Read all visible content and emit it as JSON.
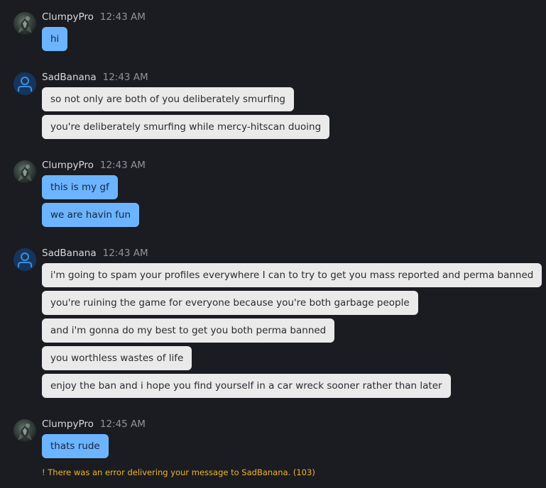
{
  "colors": {
    "background": "#1a1c22",
    "own_bubble": "#6cb4ff",
    "other_bubble": "#eaeaea",
    "error_text": "#f0b429",
    "default_avatar": "#17355c",
    "default_avatar_icon": "#3d8fe0"
  },
  "groups": [
    {
      "author": "ClumpyPro",
      "time": "12:43 AM",
      "avatar": "photo-avatar",
      "messages": [
        "hi"
      ]
    },
    {
      "author": "SadBanana",
      "time": "12:43 AM",
      "avatar": "user-icon",
      "messages": [
        "so not only are both of you deliberately smurfing",
        "you're deliberately smurfing while mercy-hitscan duoing"
      ]
    },
    {
      "author": "ClumpyPro",
      "time": "12:43 AM",
      "avatar": "photo-avatar",
      "messages": [
        "this is my gf",
        "we are havin fun"
      ]
    },
    {
      "author": "SadBanana",
      "time": "12:43 AM",
      "avatar": "user-icon",
      "messages": [
        "i'm going to spam your profiles everywhere I can to try to get you mass reported and perma banned",
        "you're ruining the game for everyone because you're both garbage people",
        "and i'm gonna do my best to get you both perma banned",
        "you worthless wastes of life",
        "enjoy the ban and i hope you find yourself in a car wreck sooner rather than later"
      ]
    },
    {
      "author": "ClumpyPro",
      "time": "12:45 AM",
      "avatar": "photo-avatar",
      "messages": [
        "thats rude"
      ],
      "error": "! There was an error delivering your message to SadBanana. (103)"
    }
  ]
}
